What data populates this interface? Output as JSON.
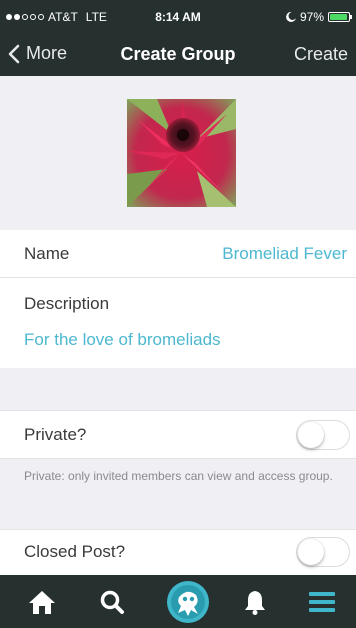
{
  "status_bar": {
    "carrier": "AT&T",
    "network": "LTE",
    "time": "8:14 AM",
    "battery_percent": "97%",
    "battery_level": 0.97
  },
  "nav": {
    "back_label": "More",
    "title": "Create Group",
    "action_label": "Create"
  },
  "group": {
    "name_label": "Name",
    "name_value": "Bromeliad Fever",
    "description_label": "Description",
    "description_value": "For the love of bromeliads"
  },
  "settings": {
    "private_label": "Private?",
    "private_on": false,
    "private_note": "Private: only invited members can view and access group.",
    "closed_post_label": "Closed Post?",
    "closed_post_on": false
  },
  "tab_bar": {
    "items": [
      {
        "icon": "home-icon"
      },
      {
        "icon": "search-icon"
      },
      {
        "icon": "brand-logo-icon"
      },
      {
        "icon": "bell-icon"
      },
      {
        "icon": "menu-icon"
      }
    ]
  },
  "colors": {
    "bar_background": "#26302f",
    "accent": "#4db8cf",
    "page_background": "#efeff4"
  }
}
